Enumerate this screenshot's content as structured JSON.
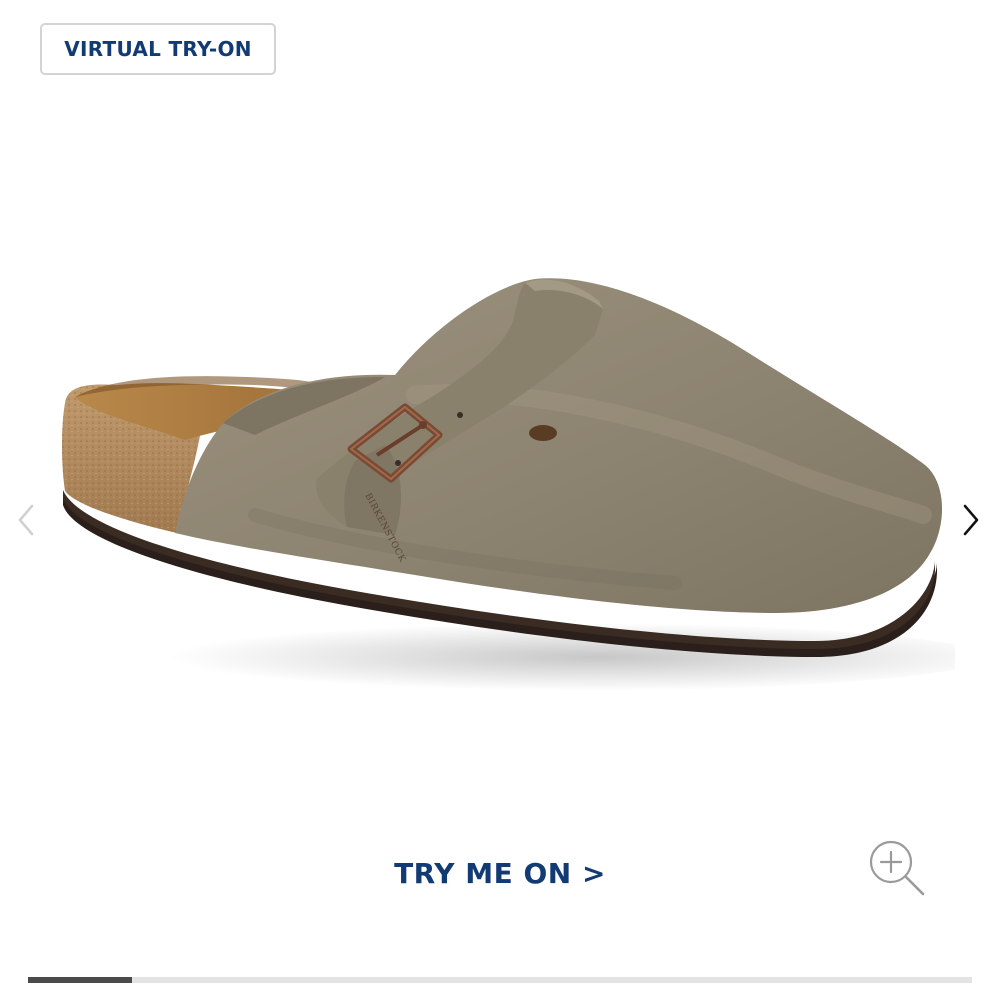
{
  "header": {
    "virtual_tryon_label": "VIRTUAL TRY-ON"
  },
  "gallery": {
    "product_image_icon": "suede-clog-image",
    "prev_icon": "chevron-left-icon",
    "next_icon": "chevron-right-icon",
    "zoom_icon": "zoom-in-icon",
    "progress_fraction": 0.11
  },
  "footer": {
    "try_me_on_label": "TRY ME ON >"
  },
  "colors": {
    "brand_navy": "#123a73",
    "suede_taupe": "#8e8572",
    "cork": "#b18a5e",
    "sole": "#2a1f1a",
    "buckle": "#7a4a34"
  }
}
